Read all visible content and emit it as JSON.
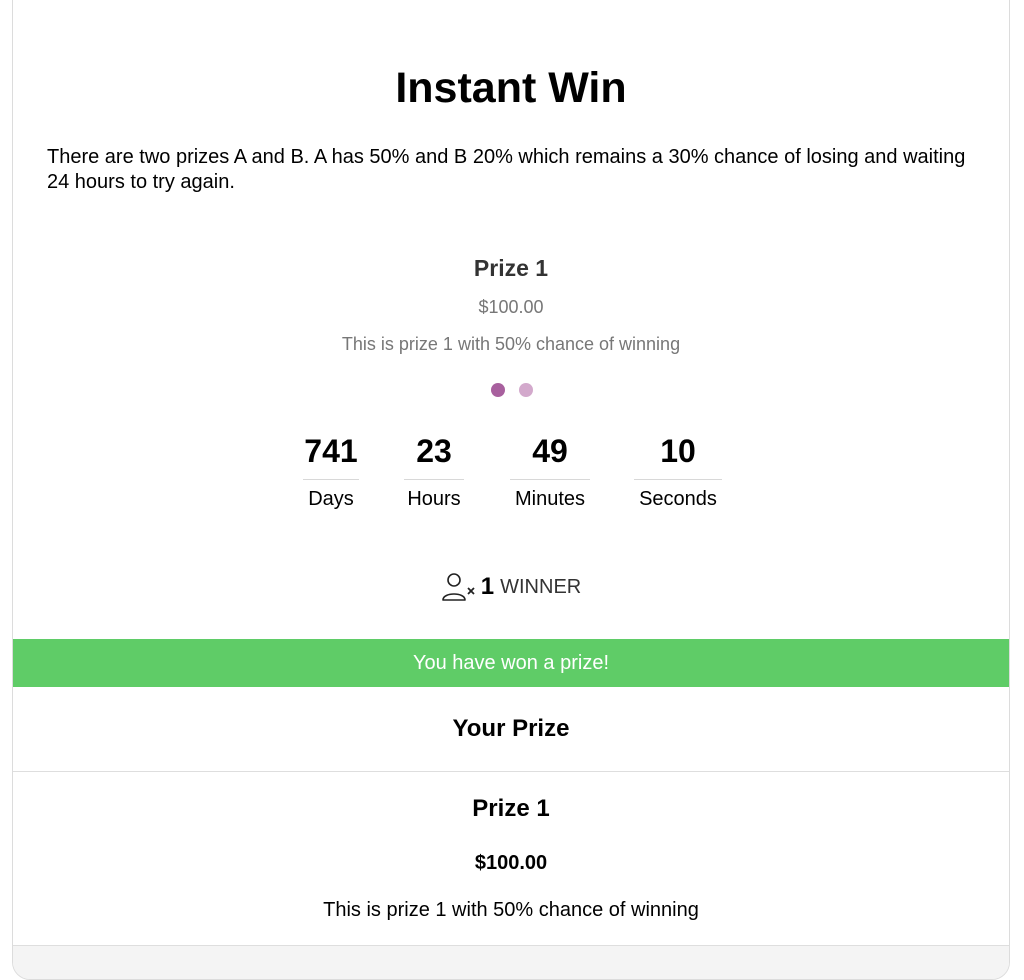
{
  "page": {
    "title": "Instant Win",
    "description": "There are two prizes A and B. A has 50% and B 20% which remains a 30% chance of losing and waiting 24 hours to try again."
  },
  "prize_preview": {
    "name": "Prize 1",
    "price": "$100.00",
    "description": "This is prize 1 with 50% chance of winning",
    "carousel_dots": 2,
    "active_dot": 1
  },
  "countdown": {
    "days_value": "741",
    "days_label": "Days",
    "hours_value": "23",
    "hours_label": "Hours",
    "minutes_value": "49",
    "minutes_label": "Minutes",
    "seconds_value": "10",
    "seconds_label": "Seconds"
  },
  "winners": {
    "icon": "user-multiply-icon",
    "count": "1",
    "label": "WINNER"
  },
  "result": {
    "banner": "You have won a prize!",
    "heading": "Your Prize",
    "prize_name": "Prize 1",
    "prize_price": "$100.00",
    "prize_description": "This is prize 1 with 50% chance of winning"
  },
  "colors": {
    "success_banner": "#5fcc67",
    "dot_active": "#a8609e",
    "dot_inactive": "#d3a9cc"
  }
}
